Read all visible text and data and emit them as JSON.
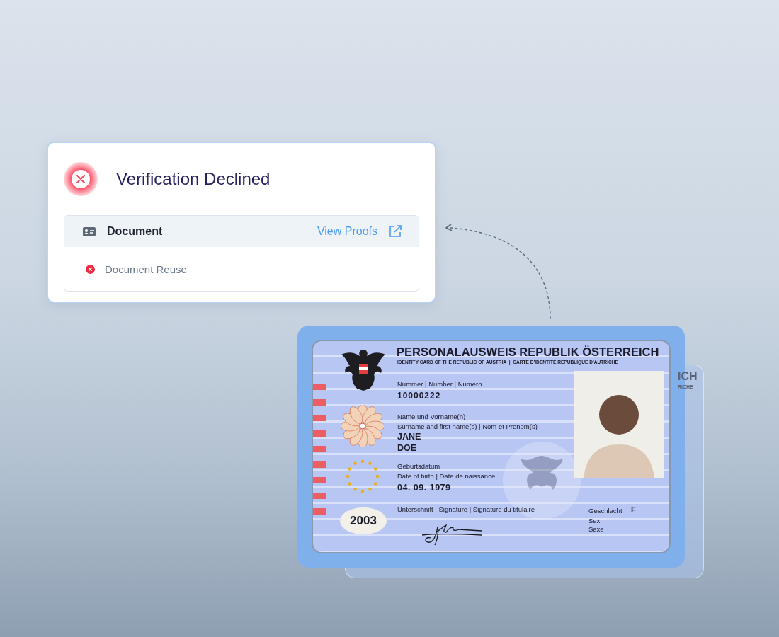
{
  "result_card": {
    "title": "Verification Declined",
    "section": {
      "title": "Document",
      "link": "View Proofs",
      "checks": [
        {
          "label": "Document Reuse",
          "failed": true
        }
      ]
    }
  },
  "id_card": {
    "title": "PERSONALAUSWEIS REPUBLIK ÖSTERREICH",
    "subtitle": "IDENTITY CARD OF THE REPUBLIC OF AUSTRIA  |  CARTE D’IDENTITE REPUBLIQUE D’AUTRICHE",
    "number_label": "Nummer | Number | Numero",
    "number": "10000222",
    "name_label": "Name und Vorname(n)",
    "name_label_2": "Surname and first name(s) | Nom et Prenom(s)",
    "first_name": "JANE",
    "last_name": "DOE",
    "birth_label": "Geburtsdatum",
    "birth_label_2": "Date of birth | Date de naissance",
    "birth_date": "04. 09. 1979",
    "signature_label": "Unterschnift | Signature | Signature du titulaire",
    "year_badge": "2003",
    "sex_label": "Geschlecht",
    "sex_value": "F",
    "sex_label_2": "Sex",
    "sex_label_3": "Sexe"
  },
  "back_card": {
    "title_fragment": "ICH",
    "subtitle_fragment": "RICHE"
  }
}
